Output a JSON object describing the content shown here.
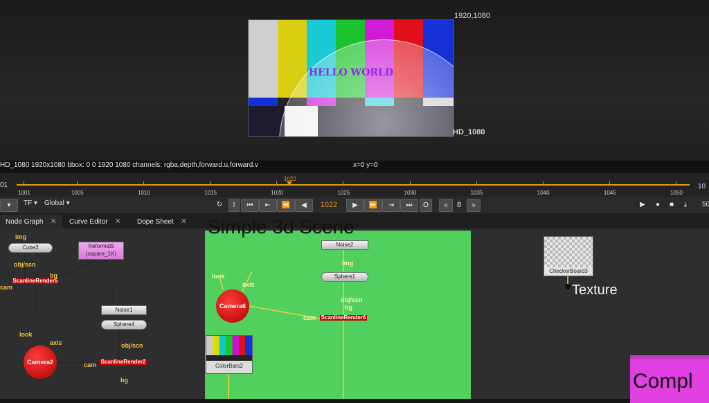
{
  "viewer": {
    "format_top": "1920,1080",
    "format_bottom": "HD_1080",
    "hello_text": "HELLO WORLD"
  },
  "infobar": {
    "info": "HD_1080 1920x1080  bbox: 0 0 1920 1080 channels: rgba,depth,forward.u,forward.v",
    "coords": "x=0 y=0"
  },
  "timeline": {
    "left_num": "01",
    "right_num": "10",
    "current_marker": "1022",
    "ticks": [
      "1001",
      "1005",
      "1010",
      "1015",
      "1020",
      "1025",
      "1030",
      "1035",
      "1040",
      "1045",
      "1050"
    ]
  },
  "transport": {
    "tf_label": "TF",
    "global_label": "Global",
    "frame": "1022",
    "step": "8",
    "i_label": "I",
    "o_label": "O",
    "right_num": "50"
  },
  "tabs": [
    "Node Graph",
    "Curve Editor",
    "Dope Sheet"
  ],
  "graph": {
    "title_3d": "Simple 3d Scene",
    "texture": "Texture",
    "complex": "Compl",
    "nodes": {
      "cube2": "Cube2",
      "reformat5": "Reformat5",
      "reformat5_sub": "(square_1K)",
      "scanline5": "ScanlineRender5",
      "noise1": "Noise1",
      "sphere4": "Sphere4",
      "camera2": "Camera2",
      "scanline2": "ScanlineRender2",
      "noise2": "Noise2",
      "sphere1": "Sphere1",
      "camera6": "Camera6",
      "scanline6": "ScanlineRender6",
      "colorbars2": "ColorBars2",
      "checker3": "CheckerBoard3"
    },
    "labels": {
      "img": "img",
      "objscn": "obj/scn",
      "bg": "bg",
      "cam": "cam",
      "look": "look",
      "axis": "axis"
    }
  },
  "colors": {
    "accent_orange": "#e59a1f",
    "node_graph_green": "#51cf5f",
    "render_red": "#c00000",
    "magenta": "#e040e0"
  }
}
